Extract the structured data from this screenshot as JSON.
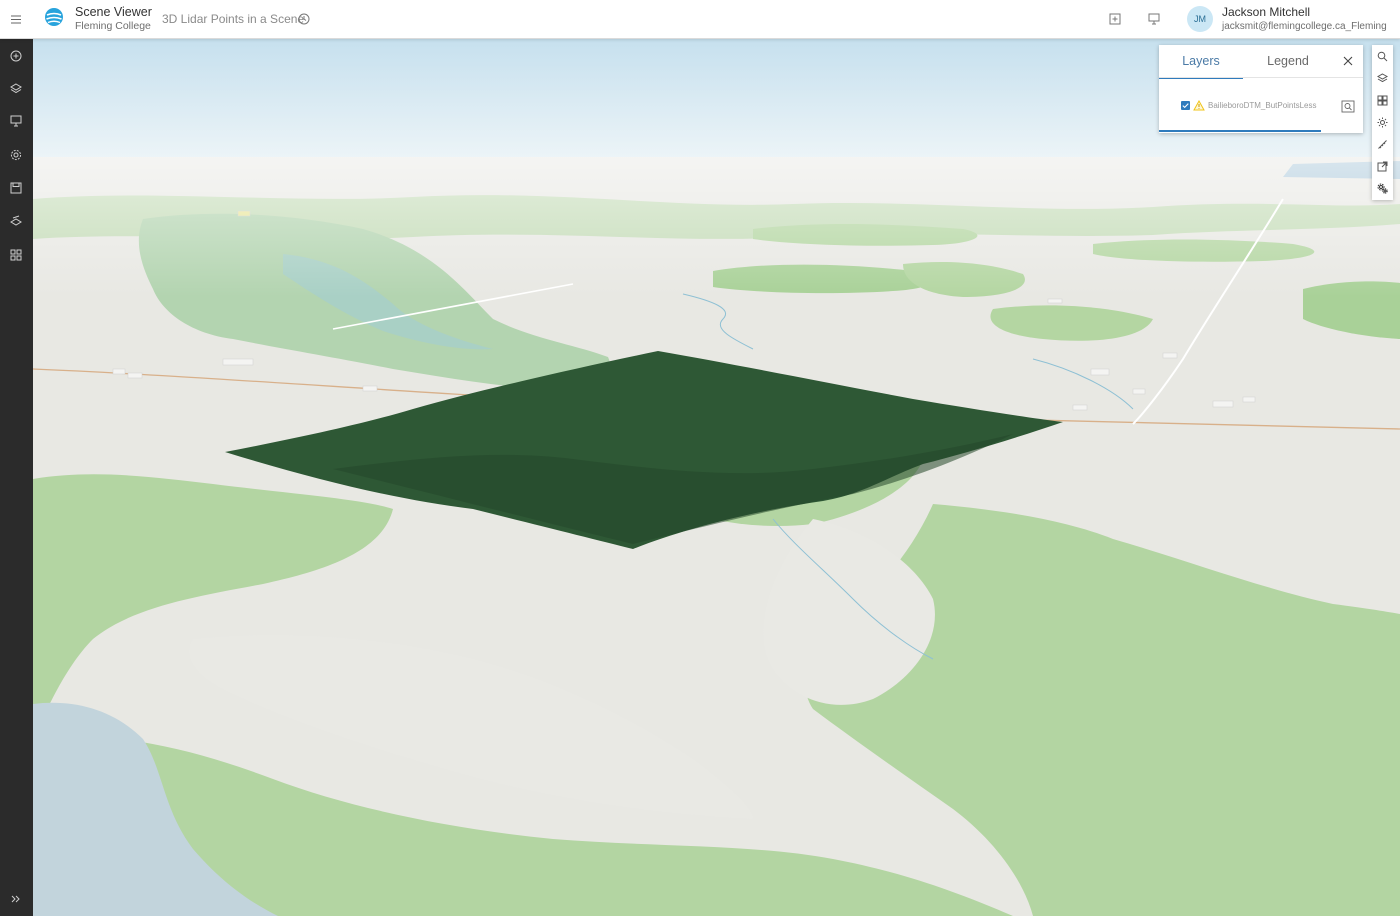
{
  "header": {
    "app_title": "Scene Viewer",
    "app_subtitle": "Fleming College",
    "scene_title": "3D Lidar Points in a Scene",
    "user_initials": "JM",
    "user_name": "Jackson Mitchell",
    "user_email": "jacksmit@flemingcollege.ca_Fleming"
  },
  "panel": {
    "tabs": [
      "Layers",
      "Legend"
    ],
    "active_tab": "Layers",
    "layers": [
      {
        "name": "BailieboroDTM_ButPointsLess",
        "visible": true,
        "warning": true
      }
    ]
  },
  "sidebar_icons": [
    "add-icon",
    "layers-icon",
    "presentation-icon",
    "settings-icon",
    "save-icon",
    "analysis-icon",
    "apps-icon",
    "expand-icon"
  ],
  "toolbar_icons": [
    "search-icon",
    "layers-icon",
    "basemap-icon",
    "daylight-icon",
    "measure-icon",
    "share-icon",
    "settings-icon"
  ],
  "colors": {
    "sidebar": "#2b2b2b",
    "accent": "#2f7bbd",
    "pointcloud": "#2e5835",
    "land_green": "#b4d6a2",
    "land_light": "#e9e9e4",
    "water": "#a8c5d8",
    "sky": "#d5e8f2"
  }
}
